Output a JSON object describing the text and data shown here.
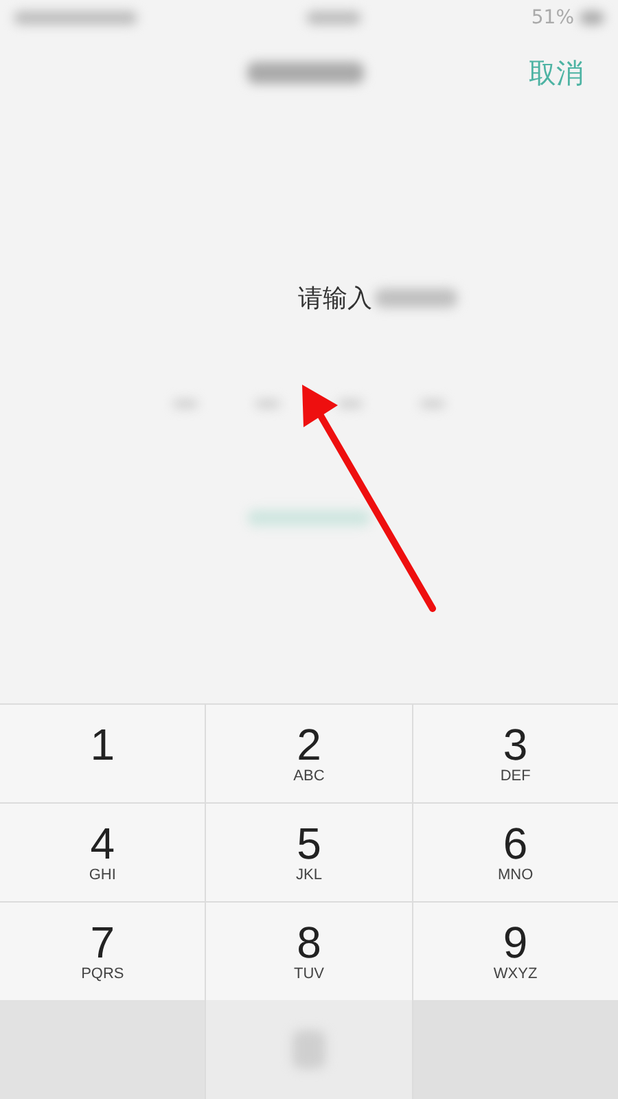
{
  "status_bar": {
    "battery": "51%"
  },
  "header": {
    "cancel": "取消"
  },
  "prompt": "请输入",
  "keys": [
    {
      "digit": "1"
    },
    {
      "digit": "2",
      "letters": "ABC"
    },
    {
      "digit": "3",
      "letters": "DEF"
    },
    {
      "digit": "4",
      "letters": "GHI"
    },
    {
      "digit": "5",
      "letters": "JKL"
    },
    {
      "digit": "6",
      "letters": "MNO"
    },
    {
      "digit": "7",
      "letters": "PQRS"
    },
    {
      "digit": "8",
      "letters": "TUV"
    },
    {
      "digit": "9",
      "letters": "WXYZ"
    }
  ]
}
